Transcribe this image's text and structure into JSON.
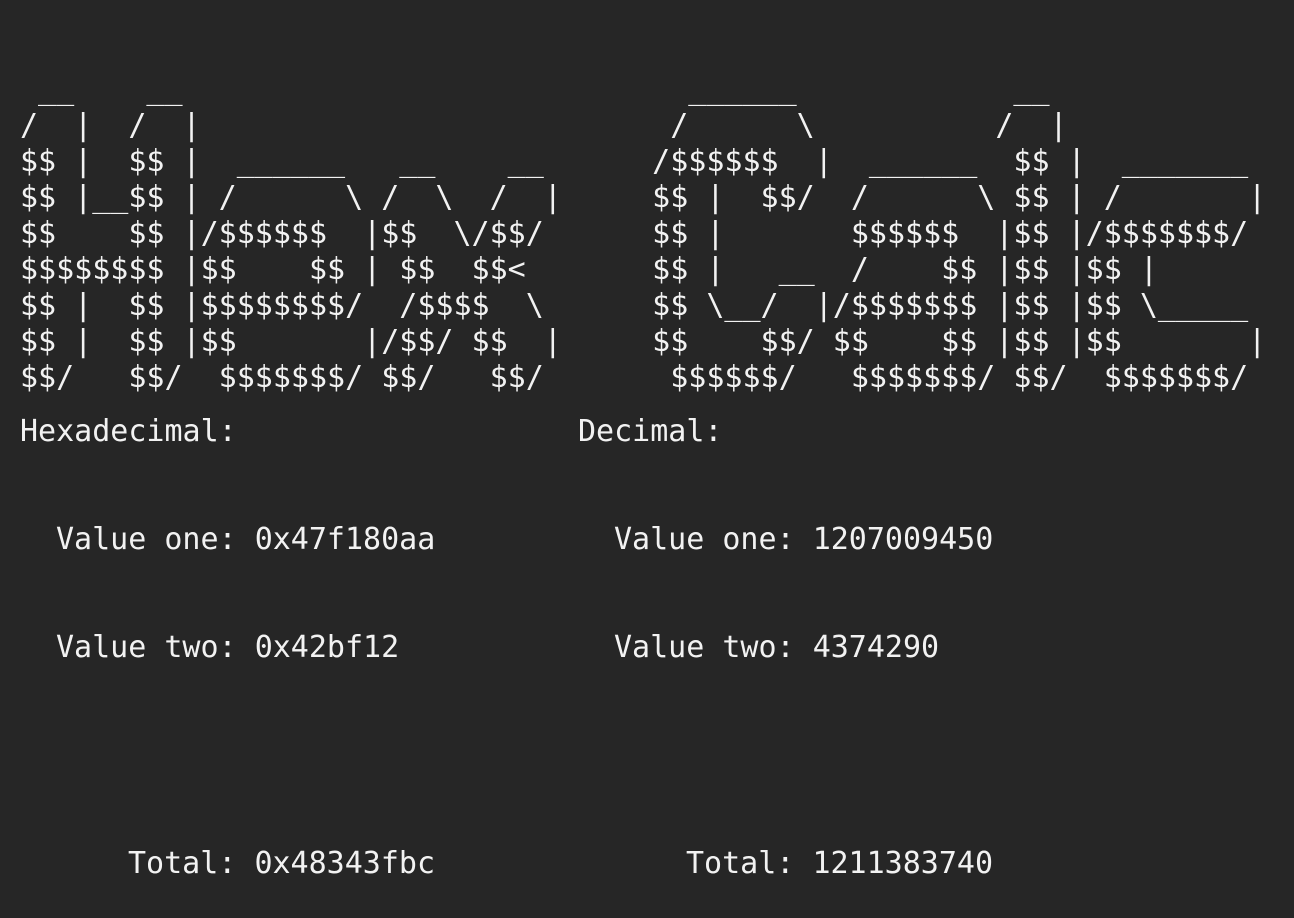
{
  "banner": {
    "lines": [
      " __    __                            ______            __",
      "/  |  /  |                          /      \\          /  |",
      "$$ |  $$ |  ______   __    __      /$$$$$$  |  ______  $$ |  _______",
      "$$ |__$$ | /      \\ /  \\  /  |     $$ |  $$/  /      \\ $$ | /       |",
      "$$    $$ |/$$$$$$  |$$  \\/$$/      $$ |       $$$$$$  |$$ |/$$$$$$$/",
      "$$$$$$$$ |$$    $$ | $$  $$<       $$ |   __  /    $$ |$$ |$$ |",
      "$$ |  $$ |$$$$$$$$/  /$$$$  \\      $$ \\__/  |/$$$$$$$ |$$ |$$ \\_____",
      "$$ |  $$ |$$       |/$$/ $$  |     $$    $$/ $$    $$ |$$ |$$       |",
      "$$/   $$/  $$$$$$$/ $$/   $$/       $$$$$$/   $$$$$$$/ $$/  $$$$$$$/"
    ]
  },
  "hex": {
    "heading": "Hexadecimal:",
    "value_one_label": "Value one:",
    "value_one": "0x47f180aa",
    "value_two_label": "Value two:",
    "value_two": "0x42bf12",
    "total_label": "Total:",
    "total": "0x48343fbc"
  },
  "dec": {
    "heading": "Decimal:",
    "value_one_label": "Value one:",
    "value_one": "1207009450",
    "value_two_label": "Value two:",
    "value_two": "4374290",
    "total_label": "Total:",
    "total": "1211383740"
  }
}
